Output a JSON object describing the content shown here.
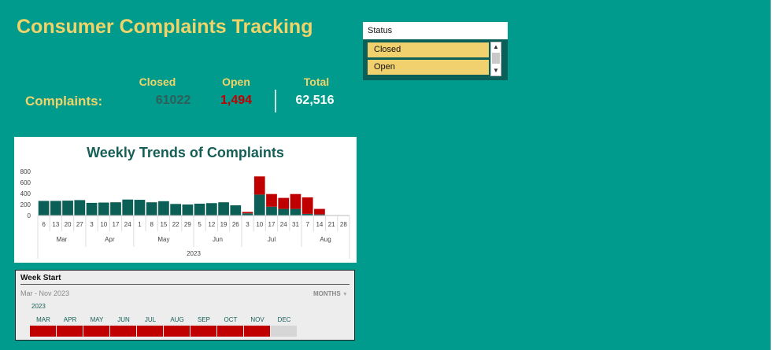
{
  "dashboard": {
    "title": "Consumer Complaints Tracking"
  },
  "kpi": {
    "label": "Complaints:",
    "closed_label": "Closed",
    "open_label": "Open",
    "total_label": "Total",
    "closed_value": "61022",
    "open_value": "1,494",
    "total_value": "62,516",
    "colors": {
      "closed": "#2e5f5a",
      "open": "#c00000",
      "total": "#ffffff",
      "heading": "#f0d46a"
    }
  },
  "slicer": {
    "header": "Status",
    "items": [
      {
        "label": "Closed",
        "selected": true
      },
      {
        "label": "Open",
        "selected": true
      }
    ],
    "scroll_up_icon": "chevron-up-icon",
    "scroll_down_icon": "chevron-down-icon"
  },
  "chart_data": {
    "type": "bar",
    "stacked": true,
    "title": "Weekly Trends of Complaints",
    "ylim": [
      0,
      800
    ],
    "yticks": [
      0,
      200,
      400,
      600,
      800
    ],
    "grid": false,
    "legend": "none",
    "categories": [
      "6",
      "13",
      "20",
      "27",
      "3",
      "10",
      "17",
      "24",
      "1",
      "8",
      "15",
      "22",
      "29",
      "5",
      "12",
      "19",
      "26",
      "3",
      "10",
      "17",
      "24",
      "31",
      "7",
      "14",
      "21",
      "28"
    ],
    "month_groups": [
      {
        "label": "Mar",
        "start": 0,
        "count": 4
      },
      {
        "label": "Apr",
        "start": 4,
        "count": 4
      },
      {
        "label": "May",
        "start": 8,
        "count": 5
      },
      {
        "label": "Jun",
        "start": 13,
        "count": 4
      },
      {
        "label": "Jul",
        "start": 17,
        "count": 5
      },
      {
        "label": "Aug",
        "start": 22,
        "count": 4
      }
    ],
    "year": "2023",
    "series": [
      {
        "name": "Closed",
        "color": "#0b5f56",
        "values": [
          265,
          265,
          270,
          280,
          230,
          235,
          240,
          290,
          285,
          240,
          260,
          210,
          200,
          215,
          225,
          240,
          185,
          40,
          380,
          160,
          120,
          120,
          30,
          20,
          0,
          0
        ]
      },
      {
        "name": "Open",
        "color": "#c00000",
        "values": [
          0,
          0,
          0,
          0,
          0,
          0,
          0,
          0,
          0,
          0,
          0,
          0,
          0,
          0,
          0,
          0,
          0,
          25,
          330,
          230,
          200,
          270,
          300,
          100,
          0,
          0
        ]
      }
    ]
  },
  "timeline": {
    "header": "Week Start",
    "range": "Mar - Nov 2023",
    "level": "MONTHS",
    "level_icon": "dropdown-arrow-icon",
    "year": "2023",
    "months": [
      "MAR",
      "APR",
      "MAY",
      "JUN",
      "JUL",
      "AUG",
      "SEP",
      "OCT",
      "NOV",
      "DEC"
    ],
    "selected": [
      true,
      true,
      true,
      true,
      true,
      true,
      true,
      true,
      true,
      false
    ],
    "colors": {
      "selected": "#c00000",
      "unselected": "#d6d6d6"
    }
  }
}
